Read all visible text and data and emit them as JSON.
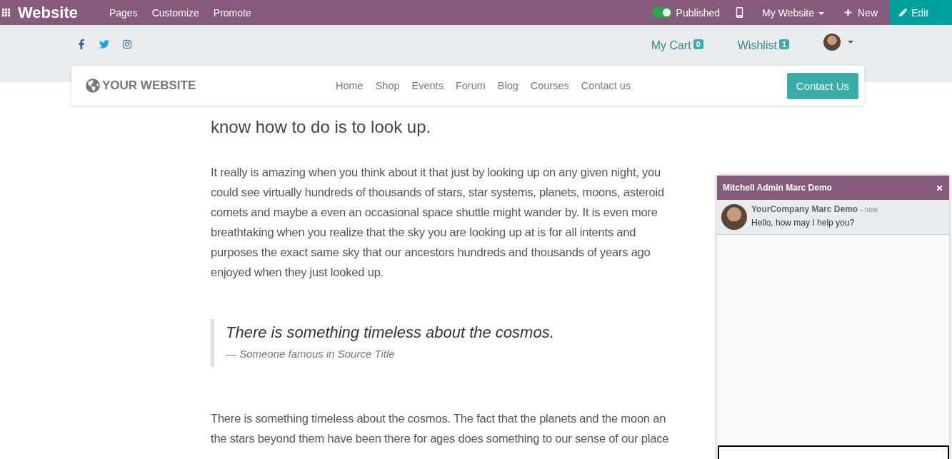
{
  "topbar": {
    "title": "Website",
    "menu": [
      "Pages",
      "Customize",
      "Promote"
    ],
    "published": {
      "label": "Published",
      "on": true
    },
    "website_menu": "My Website",
    "new_label": "New",
    "edit_label": "Edit"
  },
  "header": {
    "cart": {
      "label": "My Cart",
      "count": "0"
    },
    "wishlist": {
      "label": "Wishlist",
      "count": "1"
    }
  },
  "navbar": {
    "logo": "YOUR WEBSITE",
    "links": [
      "Home",
      "Shop",
      "Events",
      "Forum",
      "Blog",
      "Courses",
      "Contact us"
    ],
    "cta": "Contact Us"
  },
  "content": {
    "intro_lines": [
      "know how to do is to look up."
    ],
    "paragraph_1": [
      "It really is amazing when you think about it that just by looking up on any given night, you",
      "could see virtually hundreds of thousands of stars, star systems, planets, moons, asteroid",
      "comets and maybe a even an occasional space shuttle might wander by. It is even more",
      "breathtaking when you realize that the sky you are looking up at is for all intents and",
      "purposes the exact same sky that our ancestors hundreds and thousands of years ago",
      "enjoyed when they just looked up."
    ],
    "quote": {
      "text": "There is something timeless about the cosmos.",
      "source": "— Someone famous in Source Title"
    },
    "paragraph_2": [
      "There is something timeless about the cosmos. The fact that the planets and the moon an",
      "the stars beyond them have been there for ages does something to our sense of our place"
    ]
  },
  "chat": {
    "title": "Mitchell Admin Marc Demo",
    "messages": [
      {
        "author": "YourCompany Marc Demo",
        "time": "- now",
        "text": "Hello, how may I help you?"
      }
    ]
  }
}
